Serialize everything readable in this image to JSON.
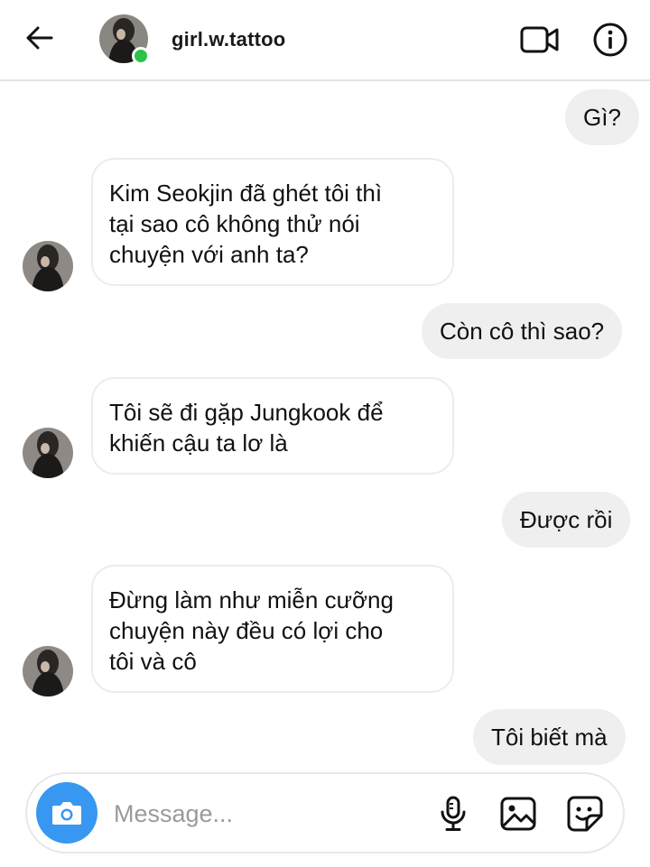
{
  "header": {
    "username": "girl.w.tattoo",
    "back_icon": "arrow-left-icon",
    "video_icon": "video-camera-icon",
    "info_icon": "info-icon",
    "online_color": "#2bc24a"
  },
  "messages": [
    {
      "from": "me",
      "text": "Gì?"
    },
    {
      "from": "them",
      "text": "Kim Seokjin đã ghét tôi thì\ntại sao cô không thử nói\nchuyện với anh ta?"
    },
    {
      "from": "me",
      "text": "Còn cô thì sao?"
    },
    {
      "from": "them",
      "text": "Tôi sẽ đi gặp Jungkook để\nkhiến cậu ta lơ là"
    },
    {
      "from": "me",
      "text": "Được rồi"
    },
    {
      "from": "them",
      "text": "Đừng làm như miễn cưỡng\nchuyện này đều có lợi cho\ntôi và cô"
    },
    {
      "from": "me",
      "text": "Tôi biết mà"
    }
  ],
  "composer": {
    "placeholder": "Message...",
    "camera_icon": "camera-icon",
    "mic_icon": "microphone-icon",
    "gallery_icon": "image-icon",
    "sticker_icon": "sticker-icon",
    "accent": "#3897f0"
  }
}
